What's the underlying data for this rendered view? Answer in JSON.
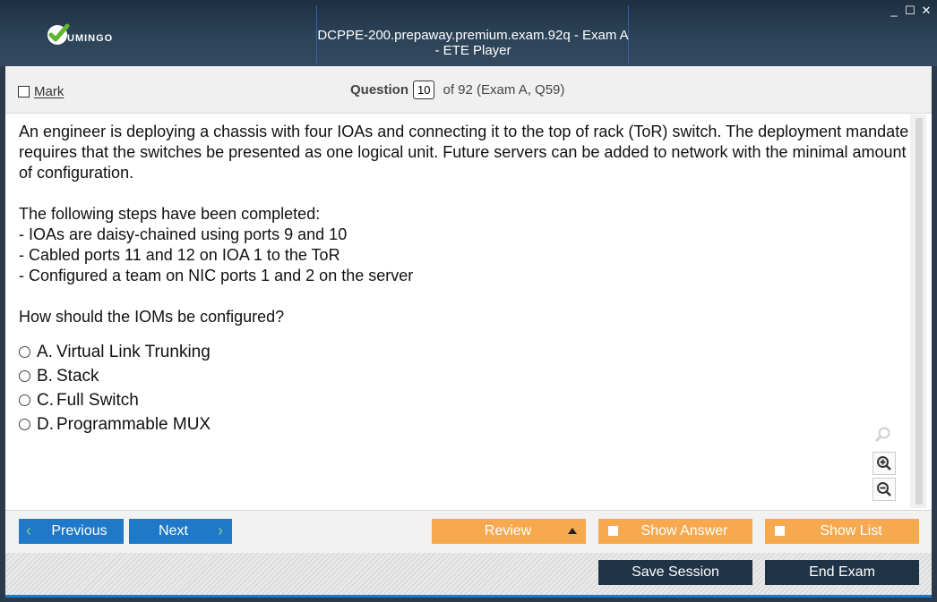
{
  "window": {
    "title": "DCPPE-200.prepaway.premium.exam.92q - Exam A - ETE Player",
    "logo_text": "UMINGO",
    "controls": {
      "minimize": "_",
      "maximize": "☐",
      "close": "✕"
    }
  },
  "question_bar": {
    "mark_label": "Mark",
    "question_label": "Question",
    "question_number": "10",
    "question_of": "of 92 (Exam A, Q59)"
  },
  "question": {
    "paragraph1": "An engineer is deploying a chassis with four IOAs and connecting it to the top of rack (ToR) switch. The deployment mandate requires that the switches be presented as one logical unit. Future servers can be added to network with the minimal amount of configuration.",
    "steps_intro": "The following steps have been completed:",
    "steps": [
      "- IOAs are daisy-chained using ports 9 and 10",
      "- Cabled ports 11 and 12 on IOA 1 to the ToR",
      "- Configured a team on NIC ports 1 and 2 on the server"
    ],
    "prompt": "How should the IOMs be configured?"
  },
  "options": [
    {
      "letter": "A.",
      "text": "Virtual Link Trunking"
    },
    {
      "letter": "B.",
      "text": "Stack"
    },
    {
      "letter": "C.",
      "text": "Full Switch"
    },
    {
      "letter": "D.",
      "text": "Programmable MUX"
    }
  ],
  "nav": {
    "previous": "Previous",
    "next": "Next",
    "review": "Review",
    "show_answer": "Show Answer",
    "show_list": "Show List",
    "save_session": "Save Session",
    "end_exam": "End Exam"
  },
  "icons": [
    "checkmark-logo-icon",
    "search-icon",
    "zoom-in-icon",
    "zoom-out-icon",
    "chevron-left-icon",
    "chevron-right-icon",
    "triangle-up-icon"
  ],
  "colors": {
    "title_bar": "#2c4358",
    "primary_button": "#1f78c8",
    "orange_button": "#f6a94e",
    "dark_button": "#1f3346"
  }
}
